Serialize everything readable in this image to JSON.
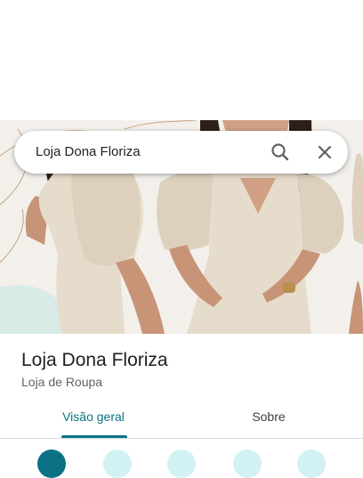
{
  "search": {
    "query": "Loja Dona Floriza"
  },
  "place": {
    "name": "Loja Dona Floriza",
    "category": "Loja de Roupa"
  },
  "tabs": [
    {
      "label": "Visão geral",
      "active": true
    },
    {
      "label": "Sobre",
      "active": false
    }
  ],
  "icons": {
    "search": "search-icon",
    "close": "close-icon"
  },
  "colors": {
    "accent": "#0b7285",
    "action_bg": "#d2f1f4",
    "dress": "#e6dccb",
    "hero_bg": "#f2efea"
  }
}
